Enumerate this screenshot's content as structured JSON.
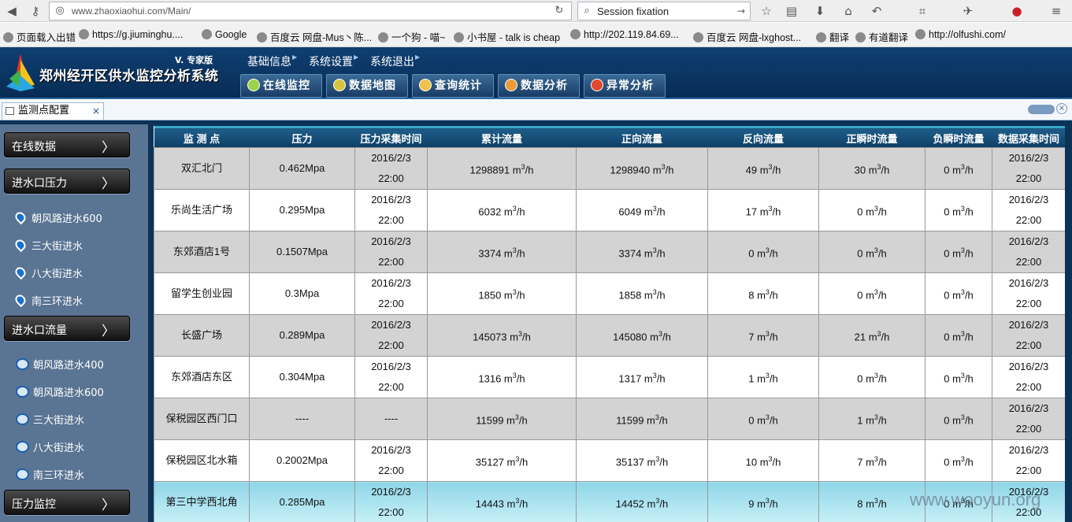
{
  "browser": {
    "url": "www.zhaoxiaohui.com/Main/",
    "search": "Session fixation",
    "bookmarks": [
      "页面载入出错",
      "https://g.jiuminghu....",
      "Google",
      "百度云 网盘-Mus丶陈...",
      "一个狗 - 喵~",
      "小书屋 - talk is cheap",
      "http://202.119.84.69...",
      "百度云 网盘-lxghost...",
      "翻译",
      "有道翻译",
      "http://olfushi.com/"
    ]
  },
  "header": {
    "system_title": "郑州经开区供水监控分析系统",
    "edition": "V. 专家版",
    "top_menu": [
      "基础信息",
      "系统设置",
      "系统退出"
    ],
    "nav_buttons": [
      "在线监控",
      "数据地图",
      "查询统计",
      "数据分析",
      "异常分析"
    ]
  },
  "tab": {
    "label": "监测点配置",
    "close": "×"
  },
  "sidebar": {
    "sections": [
      {
        "label": "在线数据",
        "items": []
      },
      {
        "label": "进水口压力",
        "items": [
          "朝风路进水600",
          "三大街进水",
          "八大街进水",
          "南三环进水"
        ]
      },
      {
        "label": "进水口流量",
        "items": [
          "朝风路进水400",
          "朝风路进水600",
          "三大街进水",
          "八大街进水",
          "南三环进水"
        ]
      },
      {
        "label": "压力监控",
        "items": []
      }
    ]
  },
  "table": {
    "columns": [
      "监 测 点",
      "压力",
      "压力采集时间",
      "累计流量",
      "正向流量",
      "反向流量",
      "正瞬时流量",
      "负瞬时流量",
      "数据采集时间"
    ],
    "unit_base": "m",
    "unit_exp": "3",
    "unit_tail": "/h",
    "rows": [
      {
        "name": "双汇北门",
        "pressure": "0.462Mpa",
        "ptime1": "2016/2/3",
        "ptime2": "22:00",
        "total": "1298891",
        "forward": "1298940",
        "reverse": "49",
        "pos_inst": "30",
        "neg_inst": "0",
        "dtime1": "2016/2/3",
        "dtime2": "22:00"
      },
      {
        "name": "乐尚生活广场",
        "pressure": "0.295Mpa",
        "ptime1": "2016/2/3",
        "ptime2": "22:00",
        "total": "6032",
        "forward": "6049",
        "reverse": "17",
        "pos_inst": "0",
        "neg_inst": "0",
        "dtime1": "2016/2/3",
        "dtime2": "22:00"
      },
      {
        "name": "东郊酒店1号",
        "pressure": "0.1507Mpa",
        "ptime1": "2016/2/3",
        "ptime2": "22:00",
        "total": "3374",
        "forward": "3374",
        "reverse": "0",
        "pos_inst": "0",
        "neg_inst": "0",
        "dtime1": "2016/2/3",
        "dtime2": "22:00"
      },
      {
        "name": "留学生创业园",
        "pressure": "0.3Mpa",
        "ptime1": "2016/2/3",
        "ptime2": "22:00",
        "total": "1850",
        "forward": "1858",
        "reverse": "8",
        "pos_inst": "0",
        "neg_inst": "0",
        "dtime1": "2016/2/3",
        "dtime2": "22:00"
      },
      {
        "name": "长盛广场",
        "pressure": "0.289Mpa",
        "ptime1": "2016/2/3",
        "ptime2": "22:00",
        "total": "145073",
        "forward": "145080",
        "reverse": "7",
        "pos_inst": "21",
        "neg_inst": "0",
        "dtime1": "2016/2/3",
        "dtime2": "22:00"
      },
      {
        "name": "东郊酒店东区",
        "pressure": "0.304Mpa",
        "ptime1": "2016/2/3",
        "ptime2": "22:00",
        "total": "1316",
        "forward": "1317",
        "reverse": "1",
        "pos_inst": "0",
        "neg_inst": "0",
        "dtime1": "2016/2/3",
        "dtime2": "22:00"
      },
      {
        "name": "保税园区西门口",
        "pressure": "----",
        "ptime1": "----",
        "ptime2": "",
        "total": "11599",
        "forward": "11599",
        "reverse": "0",
        "pos_inst": "1",
        "neg_inst": "0",
        "dtime1": "2016/2/3",
        "dtime2": "22:00"
      },
      {
        "name": "保税园区北水箱",
        "pressure": "0.2002Mpa",
        "ptime1": "2016/2/3",
        "ptime2": "22:00",
        "total": "35127",
        "forward": "35137",
        "reverse": "10",
        "pos_inst": "7",
        "neg_inst": "0",
        "dtime1": "2016/2/3",
        "dtime2": "22:00"
      },
      {
        "name": "第三中学西北角",
        "pressure": "0.285Mpa",
        "ptime1": "2016/2/3",
        "ptime2": "22:00",
        "total": "14443",
        "forward": "14452",
        "reverse": "9",
        "pos_inst": "8",
        "neg_inst": "0",
        "dtime1": "2016/2/3",
        "dtime2": "22:00"
      }
    ]
  },
  "watermark": "www.wooyun.org",
  "colors": {
    "header_bg": "#0f3f72",
    "sidebar_bg": "#5a7493",
    "row_alt": "#d3d3d3",
    "row_highlight": "#8fd6e8"
  }
}
